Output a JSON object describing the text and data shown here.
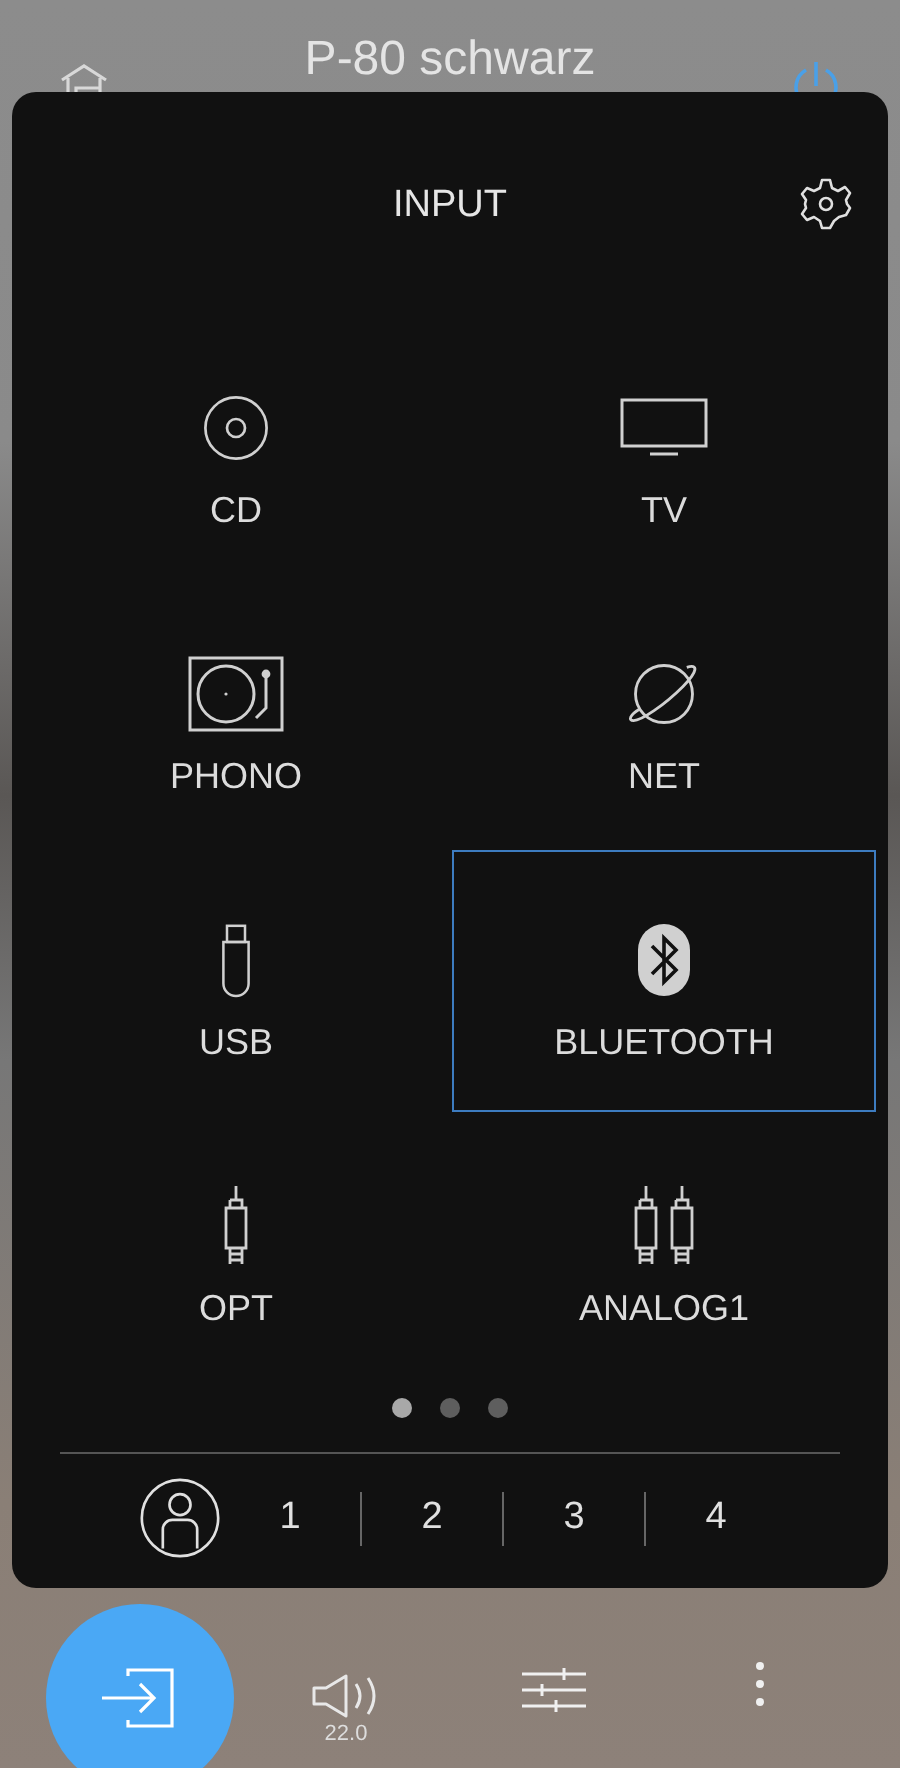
{
  "header": {
    "title": "P-80 schwarz"
  },
  "panel": {
    "title": "INPUT",
    "inputs": [
      {
        "label": "CD",
        "kind": "cd",
        "selected": false
      },
      {
        "label": "TV",
        "kind": "tv",
        "selected": false
      },
      {
        "label": "PHONO",
        "kind": "phono",
        "selected": false
      },
      {
        "label": "NET",
        "kind": "net",
        "selected": false
      },
      {
        "label": "USB",
        "kind": "usb",
        "selected": false
      },
      {
        "label": "BLUETOOTH",
        "kind": "bluetooth",
        "selected": true
      },
      {
        "label": "OPT",
        "kind": "opt",
        "selected": false
      },
      {
        "label": "ANALOG1",
        "kind": "analog",
        "selected": false
      }
    ],
    "pages": [
      {
        "selected": true
      },
      {
        "selected": false
      },
      {
        "selected": false
      }
    ],
    "presets": [
      "1",
      "2",
      "3",
      "4"
    ]
  },
  "bottom_bar": {
    "volume": "22.0"
  }
}
